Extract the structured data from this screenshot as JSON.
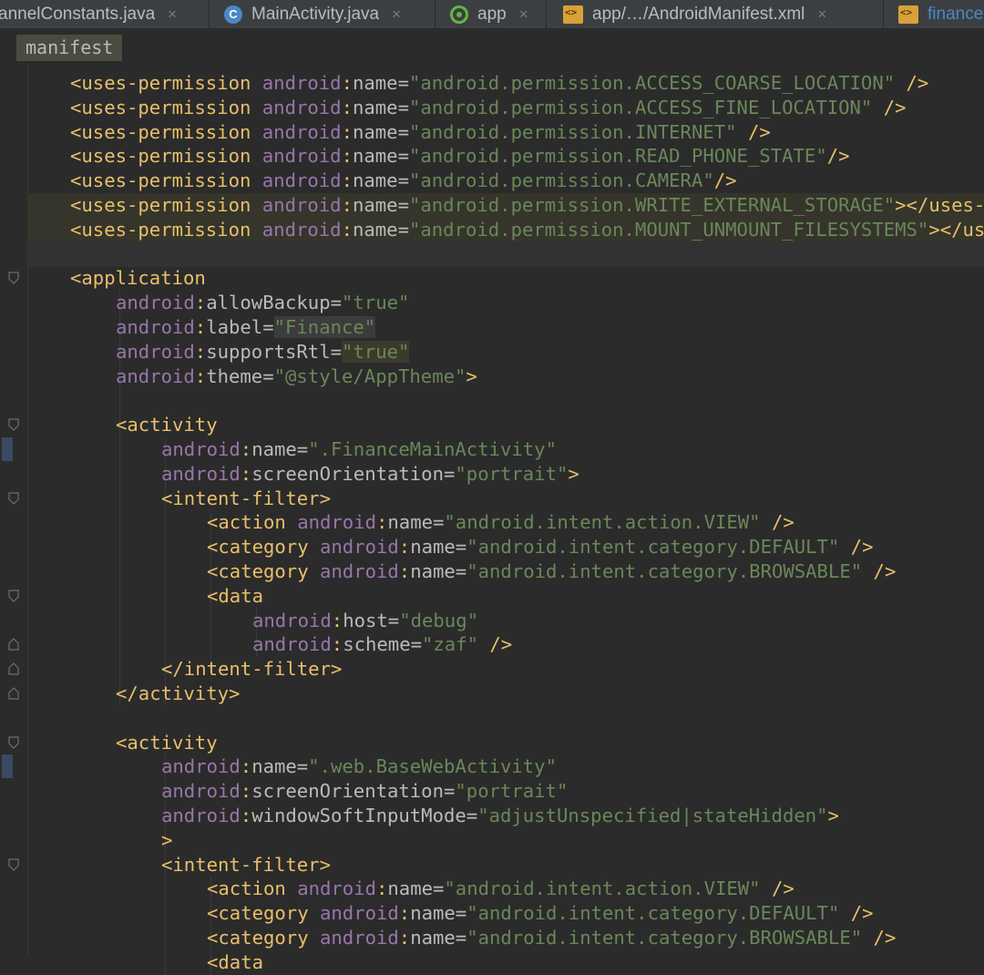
{
  "tabs": [
    {
      "label": "annelConstants.java",
      "icon": "none",
      "close": "×"
    },
    {
      "label": "MainActivity.java",
      "icon": "java-class-icon",
      "close": "×"
    },
    {
      "label": "app",
      "icon": "android-module-icon",
      "close": "×"
    },
    {
      "label": "app/…/AndroidManifest.xml",
      "icon": "xml-file-icon",
      "close": "×"
    },
    {
      "label": "finance",
      "icon": "xml-file-icon",
      "close": ""
    }
  ],
  "breadcrumb": "manifest",
  "code": [
    [
      [
        "tag",
        "<uses-permission "
      ],
      [
        "ns",
        "android"
      ],
      [
        "tag",
        ":"
      ],
      [
        "attr",
        "name="
      ],
      [
        "val",
        "\"android.permission.ACCESS_COARSE_LOCATION\""
      ],
      [
        "tag",
        " />"
      ]
    ],
    [
      [
        "tag",
        "<uses-permission "
      ],
      [
        "ns",
        "android"
      ],
      [
        "tag",
        ":"
      ],
      [
        "attr",
        "name="
      ],
      [
        "val",
        "\"android.permission.ACCESS_FINE_LOCATION\""
      ],
      [
        "tag",
        " />"
      ]
    ],
    [
      [
        "tag",
        "<uses-permission "
      ],
      [
        "ns",
        "android"
      ],
      [
        "tag",
        ":"
      ],
      [
        "attr",
        "name="
      ],
      [
        "val",
        "\"android.permission.INTERNET\""
      ],
      [
        "tag",
        " />"
      ]
    ],
    [
      [
        "tag",
        "<uses-permission "
      ],
      [
        "ns",
        "android"
      ],
      [
        "tag",
        ":"
      ],
      [
        "attr",
        "name="
      ],
      [
        "val",
        "\"android.permission.READ_PHONE_STATE\""
      ],
      [
        "tag",
        "/>"
      ]
    ],
    [
      [
        "tag",
        "<uses-permission "
      ],
      [
        "ns",
        "android"
      ],
      [
        "tag",
        ":"
      ],
      [
        "attr",
        "name="
      ],
      [
        "val",
        "\"android.permission.CAMERA\""
      ],
      [
        "tag",
        "/>"
      ]
    ],
    [
      [
        "tag",
        "<uses-permission "
      ],
      [
        "ns",
        "android"
      ],
      [
        "tag",
        ":"
      ],
      [
        "attr",
        "name="
      ],
      [
        "val",
        "\"android.permission.WRITE_EXTERNAL_STORAGE\""
      ],
      [
        "tag",
        "></uses-"
      ]
    ],
    [
      [
        "tag",
        "<uses-permission "
      ],
      [
        "ns",
        "android"
      ],
      [
        "tag",
        ":"
      ],
      [
        "attr",
        "name="
      ],
      [
        "val",
        "\"android.permission.MOUNT_UNMOUNT_FILESYSTEMS\""
      ],
      [
        "tag",
        "></us"
      ]
    ],
    [],
    [
      [
        "tag",
        "<application"
      ]
    ],
    [
      [
        "ns",
        "android"
      ],
      [
        "tag",
        ":"
      ],
      [
        "attr",
        "allowBackup="
      ],
      [
        "val",
        "\"true\""
      ]
    ],
    [
      [
        "ns",
        "android"
      ],
      [
        "tag",
        ":"
      ],
      [
        "attr",
        "label="
      ],
      [
        "val",
        "\"Finance\""
      ]
    ],
    [
      [
        "ns",
        "android"
      ],
      [
        "tag",
        ":"
      ],
      [
        "attr",
        "supportsRtl="
      ],
      [
        "val",
        "\"true\""
      ]
    ],
    [
      [
        "ns",
        "android"
      ],
      [
        "tag",
        ":"
      ],
      [
        "attr",
        "theme="
      ],
      [
        "val",
        "\"@style/AppTheme\""
      ],
      [
        "tag",
        ">"
      ]
    ],
    [],
    [
      [
        "tag",
        "<activity"
      ]
    ],
    [
      [
        "ns",
        "android"
      ],
      [
        "tag",
        ":"
      ],
      [
        "attr",
        "name="
      ],
      [
        "val",
        "\".FinanceMainActivity\""
      ]
    ],
    [
      [
        "ns",
        "android"
      ],
      [
        "tag",
        ":"
      ],
      [
        "attr",
        "screenOrientation="
      ],
      [
        "val",
        "\"portrait\""
      ],
      [
        "tag",
        ">"
      ]
    ],
    [
      [
        "tag",
        "<intent-filter>"
      ]
    ],
    [
      [
        "tag",
        "<action "
      ],
      [
        "ns",
        "android"
      ],
      [
        "tag",
        ":"
      ],
      [
        "attr",
        "name="
      ],
      [
        "val",
        "\"android.intent.action.VIEW\""
      ],
      [
        "tag",
        " />"
      ]
    ],
    [
      [
        "tag",
        "<category "
      ],
      [
        "ns",
        "android"
      ],
      [
        "tag",
        ":"
      ],
      [
        "attr",
        "name="
      ],
      [
        "val",
        "\"android.intent.category.DEFAULT\""
      ],
      [
        "tag",
        " />"
      ]
    ],
    [
      [
        "tag",
        "<category "
      ],
      [
        "ns",
        "android"
      ],
      [
        "tag",
        ":"
      ],
      [
        "attr",
        "name="
      ],
      [
        "val",
        "\"android.intent.category.BROWSABLE\""
      ],
      [
        "tag",
        " />"
      ]
    ],
    [
      [
        "tag",
        "<data"
      ]
    ],
    [
      [
        "ns",
        "android"
      ],
      [
        "tag",
        ":"
      ],
      [
        "attr",
        "host="
      ],
      [
        "val",
        "\"debug\""
      ]
    ],
    [
      [
        "ns",
        "android"
      ],
      [
        "tag",
        ":"
      ],
      [
        "attr",
        "scheme="
      ],
      [
        "val",
        "\"zaf\""
      ],
      [
        "tag",
        " />"
      ]
    ],
    [
      [
        "tag",
        "</intent-filter>"
      ]
    ],
    [
      [
        "tag",
        "</activity>"
      ]
    ],
    [],
    [
      [
        "tag",
        "<activity"
      ]
    ],
    [
      [
        "ns",
        "android"
      ],
      [
        "tag",
        ":"
      ],
      [
        "attr",
        "name="
      ],
      [
        "val",
        "\".web.BaseWebActivity\""
      ]
    ],
    [
      [
        "ns",
        "android"
      ],
      [
        "tag",
        ":"
      ],
      [
        "attr",
        "screenOrientation="
      ],
      [
        "val",
        "\"portrait\""
      ]
    ],
    [
      [
        "ns",
        "android"
      ],
      [
        "tag",
        ":"
      ],
      [
        "attr",
        "windowSoftInputMode="
      ],
      [
        "val",
        "\"adjustUnspecified|stateHidden\""
      ],
      [
        "tag",
        ">"
      ]
    ],
    [
      [
        "tag",
        ">"
      ]
    ],
    [
      [
        "tag",
        "<intent-filter>"
      ]
    ],
    [
      [
        "tag",
        "<action "
      ],
      [
        "ns",
        "android"
      ],
      [
        "tag",
        ":"
      ],
      [
        "attr",
        "name="
      ],
      [
        "val",
        "\"android.intent.action.VIEW\""
      ],
      [
        "tag",
        " />"
      ]
    ],
    [
      [
        "tag",
        "<category "
      ],
      [
        "ns",
        "android"
      ],
      [
        "tag",
        ":"
      ],
      [
        "attr",
        "name="
      ],
      [
        "val",
        "\"android.intent.category.DEFAULT\""
      ],
      [
        "tag",
        " />"
      ]
    ],
    [
      [
        "tag",
        "<category "
      ],
      [
        "ns",
        "android"
      ],
      [
        "tag",
        ":"
      ],
      [
        "attr",
        "name="
      ],
      [
        "val",
        "\"android.intent.category.BROWSABLE\""
      ],
      [
        "tag",
        " />"
      ]
    ],
    [
      [
        "tag",
        "<data"
      ]
    ]
  ],
  "colors": {
    "background": "#2b2b2b",
    "tag": "#e8bf6a",
    "namespace": "#9876aa",
    "attribute": "#bababa",
    "value": "#6a8759",
    "highlighted_line": "#35352b"
  }
}
